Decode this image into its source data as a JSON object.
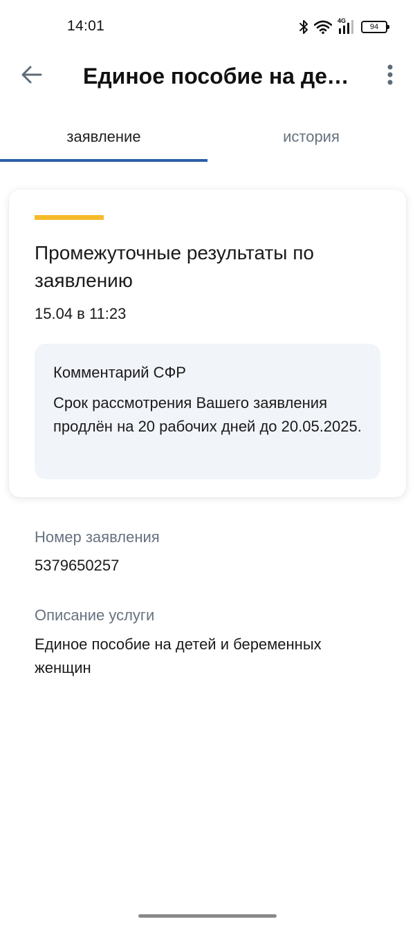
{
  "status_bar": {
    "time": "14:01",
    "network_label": "4G",
    "battery_level": "94",
    "icons": [
      "bluetooth-icon",
      "wifi-icon",
      "signal-icon",
      "battery-icon"
    ]
  },
  "header": {
    "title": "Единое пособие на дет…",
    "back_icon": "arrow-left-icon",
    "menu_icon": "more-vertical-icon"
  },
  "tabs": [
    {
      "label": "заявление",
      "active": true
    },
    {
      "label": "история",
      "active": false
    }
  ],
  "card": {
    "accent_color": "#f6bb2c",
    "title": "Промежуточные результаты по заявлению",
    "date": "15.04 в 11:23",
    "comment": {
      "title": "Комментарий СФР",
      "text": "Срок рассмотрения Вашего заявления продлён на 20 рабочих дней до 20.05.2025."
    }
  },
  "details": [
    {
      "label": "Номер заявления",
      "value": "5379650257"
    },
    {
      "label": "Описание услуги",
      "value": "Единое пособие на детей и беременных женщин"
    }
  ],
  "colors": {
    "tab_indicator": "#2a5ea8",
    "muted_text": "#66727f",
    "comment_bg": "#f1f4f9"
  }
}
